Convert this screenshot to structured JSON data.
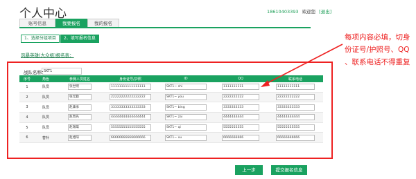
{
  "header": {
    "title": "个人中心",
    "phone": "18610403393",
    "greeting": "欢迎您",
    "logout": "[退出]"
  },
  "tabs": [
    {
      "label": "账号信息"
    },
    {
      "label": "我要报名"
    },
    {
      "label": "我的报名"
    }
  ],
  "steps": [
    {
      "label": "1、选择分组项目"
    },
    {
      "label": "2、填写报名信息"
    }
  ],
  "subtitle": "风暴英雄(大众组)报名表：",
  "team": {
    "label": "战队名称：",
    "value": "SKT1"
  },
  "table": {
    "headers": [
      "序号",
      "角色",
      "参赛人员姓名",
      "身份证号/护照",
      "ID",
      "QQ",
      "联系电话"
    ],
    "rows": [
      {
        "no": "1",
        "role": "队员",
        "name": "张世明",
        "idcard": "11111111111111111",
        "gid": "SKT1~ shi",
        "qq": "1111111111",
        "phone": "11111111111"
      },
      {
        "no": "2",
        "role": "队员",
        "name": "张尤勤",
        "idcard": "22222222222222222",
        "gid": "SKT1~ you",
        "qq": "2222222222",
        "phone": "22222222222"
      },
      {
        "no": "3",
        "role": "队员",
        "name": "赵康承",
        "idcard": "33333333333333333",
        "gid": "SKT1~ bing",
        "qq": "3333333333",
        "phone": "33333333333"
      },
      {
        "no": "4",
        "role": "队员",
        "name": "赵周先",
        "idcard": "44444444444444444",
        "gid": "SKT1~ zai",
        "qq": "4444444444",
        "phone": "44444444444"
      },
      {
        "no": "5",
        "role": "队员",
        "name": "赵瑞琪",
        "idcard": "55555555555555555",
        "gid": "SKT1~ qi",
        "qq": "5555555555",
        "phone": "55555555555"
      },
      {
        "no": "6",
        "role": "替补",
        "name": "赵旭阳",
        "idcard": "66666666666666666",
        "gid": "SKT1~ xu",
        "qq": "6666666666",
        "phone": "66666666666"
      }
    ]
  },
  "annotation": {
    "line1": "每项内容必填，切身",
    "line2": "份证号/护照号、QQ",
    "line3": "、联系电话不得重复"
  },
  "buttons": {
    "prev": "上一步",
    "submit": "提交报名信息"
  },
  "colors": {
    "brand": "#1aa260",
    "annotation": "#e22222"
  }
}
